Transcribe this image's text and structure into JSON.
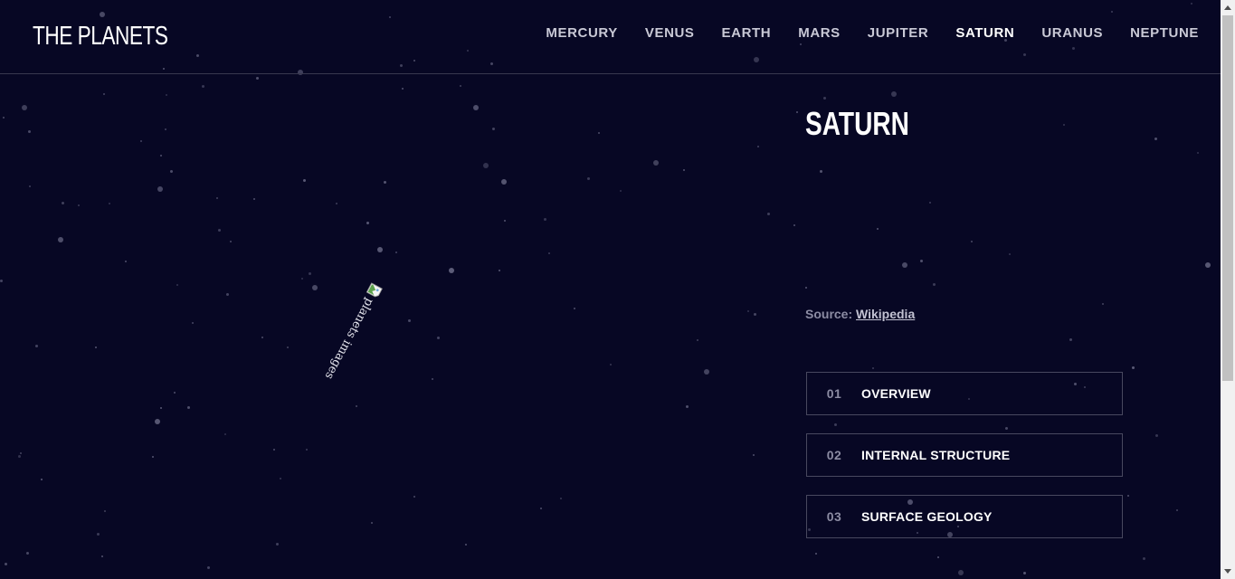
{
  "header": {
    "logo": "THE PLANETS",
    "nav": [
      {
        "label": "MERCURY",
        "active": false
      },
      {
        "label": "VENUS",
        "active": false
      },
      {
        "label": "EARTH",
        "active": false
      },
      {
        "label": "MARS",
        "active": false
      },
      {
        "label": "JUPITER",
        "active": false
      },
      {
        "label": "SATURN",
        "active": true
      },
      {
        "label": "URANUS",
        "active": false
      },
      {
        "label": "NEPTUNE",
        "active": false
      }
    ]
  },
  "main": {
    "image_alt": "planets images",
    "title": "SATURN",
    "source_prefix": "Source:",
    "source_link": "Wikipedia",
    "tabs": [
      {
        "num": "01",
        "label": "OVERVIEW"
      },
      {
        "num": "02",
        "label": "INTERNAL STRUCTURE"
      },
      {
        "num": "03",
        "label": "SURFACE GEOLOGY"
      }
    ]
  },
  "colors": {
    "background": "#070724",
    "divider": "#38384f",
    "tab_border": "#48485f",
    "muted_text": "#8c8ca3",
    "star": "#5c5c78"
  }
}
